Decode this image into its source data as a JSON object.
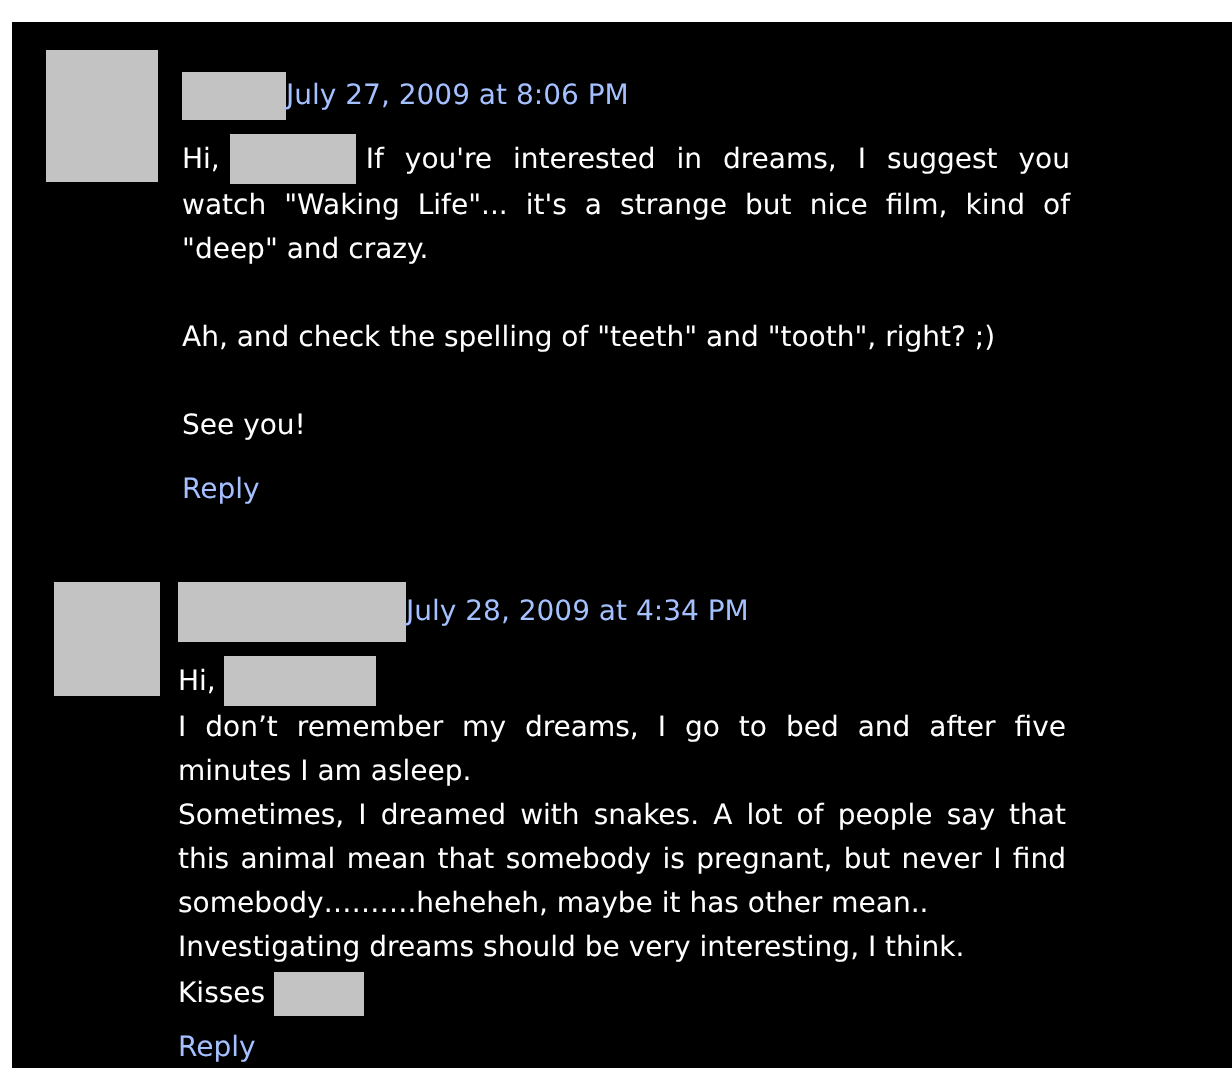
{
  "comments": [
    {
      "date": "July 27, 2009 at 8:06 PM",
      "paragraphs": [
        [
          [
            {
              "kind": "text",
              "text": "Hi,"
            },
            {
              "kind": "redacted"
            },
            {
              "kind": "text",
              "text": "If you're interested in dreams, I suggest you"
            }
          ],
          [
            {
              "kind": "text",
              "text": "watch \"Waking Life\"... it's a strange but nice film, kind of \"deep\" and crazy."
            }
          ]
        ],
        [
          [
            {
              "kind": "text",
              "text": "Ah, and check the spelling of \"teeth\" and \"tooth\", right? ;)"
            }
          ]
        ],
        [
          [
            {
              "kind": "text",
              "text": "See you!"
            }
          ]
        ]
      ],
      "reply": "Reply"
    },
    {
      "date": "July 28, 2009 at 4:34 PM",
      "paragraphs": [
        [
          [
            {
              "kind": "text",
              "text": "Hi,"
            },
            {
              "kind": "redacted"
            }
          ],
          [
            {
              "kind": "text",
              "text": "I don’t remember my dreams, I go to bed and after five minutes I am asleep."
            }
          ],
          [
            {
              "kind": "text",
              "text": "Sometimes, I dreamed with snakes. A lot of people say that this animal mean that somebody is pregnant, but never I find somebody……….heheheh, maybe it has other mean.."
            }
          ],
          [
            {
              "kind": "text",
              "text": "Investigating dreams should be very interesting, I think."
            }
          ],
          [
            {
              "kind": "text",
              "text": "Kisses"
            },
            {
              "kind": "redacted"
            }
          ]
        ]
      ],
      "reply": "Reply"
    }
  ]
}
